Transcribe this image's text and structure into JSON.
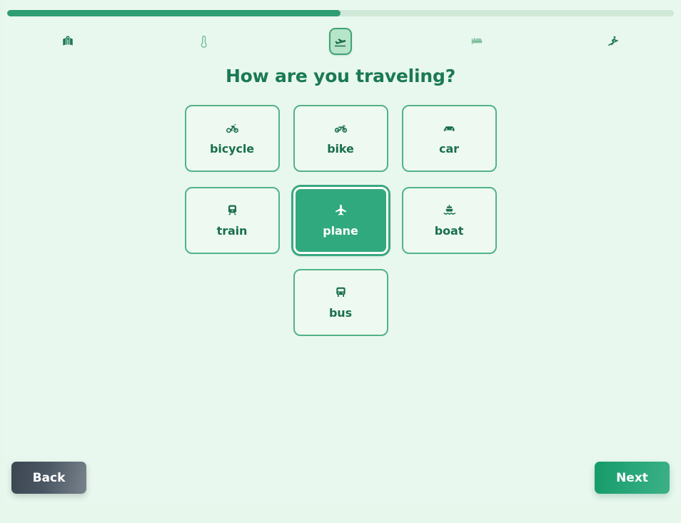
{
  "progress": {
    "percent": 50,
    "fill_color": "#2f9e72",
    "track_color": "#cfe8d7"
  },
  "steps": [
    {
      "id": "destination",
      "icon": "map-pinned-icon",
      "state": "done"
    },
    {
      "id": "weather",
      "icon": "thermometer-icon",
      "state": "upcoming"
    },
    {
      "id": "transport",
      "icon": "plane-takeoff-icon",
      "state": "current"
    },
    {
      "id": "lodging",
      "icon": "bed-icon",
      "state": "upcoming"
    },
    {
      "id": "activities",
      "icon": "skiing-icon",
      "state": "done"
    }
  ],
  "main": {
    "title": "How are you traveling?",
    "options": [
      {
        "id": "bicycle",
        "label": "bicycle",
        "icon": "bicycle-icon",
        "selected": false
      },
      {
        "id": "bike",
        "label": "bike",
        "icon": "motorcycle-icon",
        "selected": false
      },
      {
        "id": "car",
        "label": "car",
        "icon": "car-icon",
        "selected": false
      },
      {
        "id": "train",
        "label": "train",
        "icon": "train-icon",
        "selected": false
      },
      {
        "id": "plane",
        "label": "plane",
        "icon": "plane-icon",
        "selected": true
      },
      {
        "id": "boat",
        "label": "boat",
        "icon": "boat-icon",
        "selected": false
      },
      {
        "id": "bus",
        "label": "bus",
        "icon": "bus-icon",
        "selected": false
      }
    ]
  },
  "footer": {
    "back_label": "Back",
    "next_label": "Next"
  },
  "colors": {
    "background": "#e8f7ec",
    "accent": "#31a97e",
    "title": "#1a7a52",
    "card_border": "#52b288",
    "card_background": "#eefaf1"
  }
}
